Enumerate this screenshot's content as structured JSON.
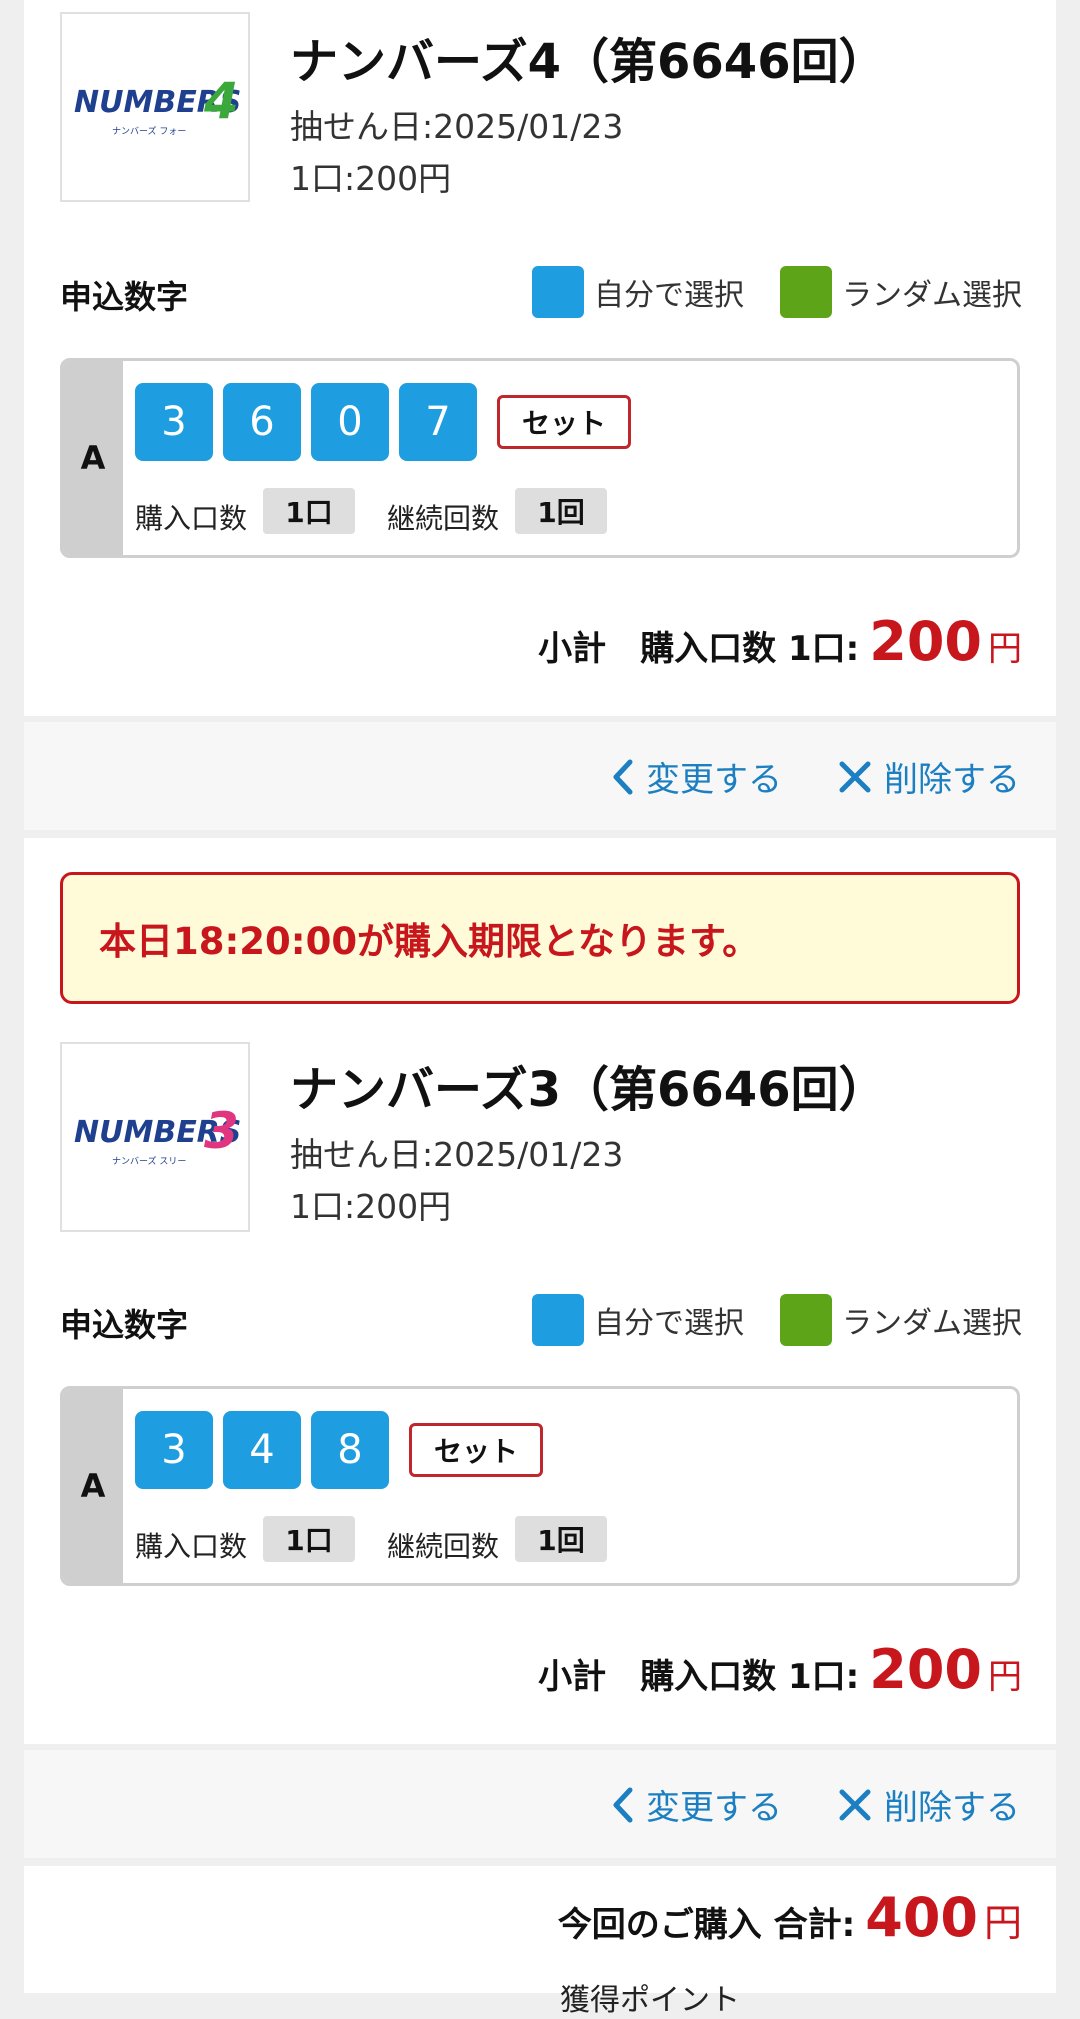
{
  "colors": {
    "self_select": "#1e9ee0",
    "random_select": "#5da418",
    "accent_red": "#c8161d",
    "link_blue": "#1b7fc2"
  },
  "items": [
    {
      "logo_word": "NUMBERS",
      "logo_digit": "4",
      "logo_sub": "ナンバーズ フォー",
      "title": "ナンバーズ4（第6646回）",
      "draw_date": "抽せん日:2025/01/23",
      "unit_price": "1口:200円",
      "section_label": "申込数字",
      "legend_self": "自分で選択",
      "legend_random": "ランダム選択",
      "entry": {
        "tag": "A",
        "numbers": [
          "3",
          "6",
          "0",
          "7"
        ],
        "set_label": "セット",
        "purchase_label": "購入口数",
        "purchase_value": "1口",
        "repeat_label": "継続回数",
        "repeat_value": "1回"
      },
      "subtotal_label": "小計　購入口数 1口:",
      "subtotal_amount": "200",
      "yen": "円",
      "change_label": "変更する",
      "delete_label": "削除する"
    },
    {
      "deadline_notice": "本日18:20:00が購入期限となります。",
      "logo_word": "NUMBERS",
      "logo_digit": "3",
      "logo_sub": "ナンバーズ スリー",
      "title": "ナンバーズ3（第6646回）",
      "draw_date": "抽せん日:2025/01/23",
      "unit_price": "1口:200円",
      "section_label": "申込数字",
      "legend_self": "自分で選択",
      "legend_random": "ランダム選択",
      "entry": {
        "tag": "A",
        "numbers": [
          "3",
          "4",
          "8"
        ],
        "set_label": "セット",
        "purchase_label": "購入口数",
        "purchase_value": "1口",
        "repeat_label": "継続回数",
        "repeat_value": "1回"
      },
      "subtotal_label": "小計　購入口数 1口:",
      "subtotal_amount": "200",
      "yen": "円",
      "change_label": "変更する",
      "delete_label": "削除する"
    }
  ],
  "total": {
    "label": "今回のご購入 合計:",
    "amount": "400",
    "yen": "円",
    "cut_off_text": "獲得ポイント"
  }
}
